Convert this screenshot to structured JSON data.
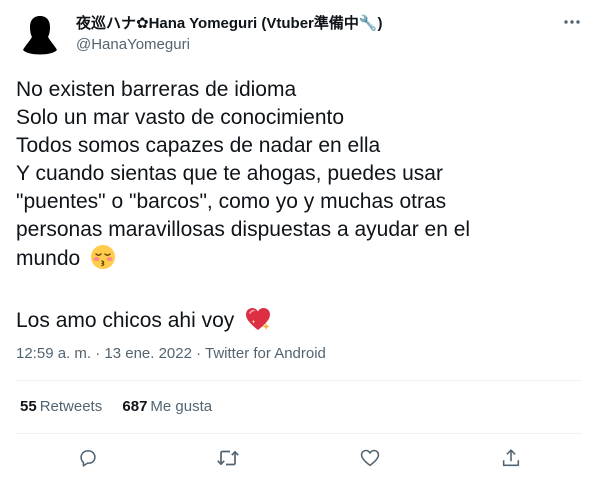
{
  "author": {
    "display_name": "夜巡ハナ✿Hana Yomeguri (Vtuber準備中🔧)",
    "handle": "@HanaYomeguri"
  },
  "tweet": {
    "lines": [
      "No existen barreras de idioma",
      "Solo un mar vasto de conocimiento",
      "Todos somos capazes de nadar en ella",
      "Y cuando sientas que te ahogas, puedes usar",
      "\"puentes\" o \"barcos\", como yo y muchas otras",
      "personas maravillosas dispuestas a ayudar en el",
      "mundo",
      "Los amo chicos ahi voy"
    ],
    "timestamp": "12:59 a. m. · 13 ene. 2022 · Twitter for Android"
  },
  "stats": {
    "retweets_count": "55",
    "retweets_label": "Retweets",
    "likes_count": "687",
    "likes_label": "Me gusta"
  },
  "icons": {
    "more": "more-horizontal-icon",
    "reply": "reply-icon",
    "retweet": "retweet-icon",
    "like": "heart-icon",
    "share": "share-icon",
    "emoji_kiss": "kissing-closed-eyes-emoji",
    "emoji_heart": "sparkling-heart-emoji"
  },
  "colors": {
    "text": "#0f1419",
    "secondary": "#536471",
    "divider": "#eff3f4"
  }
}
